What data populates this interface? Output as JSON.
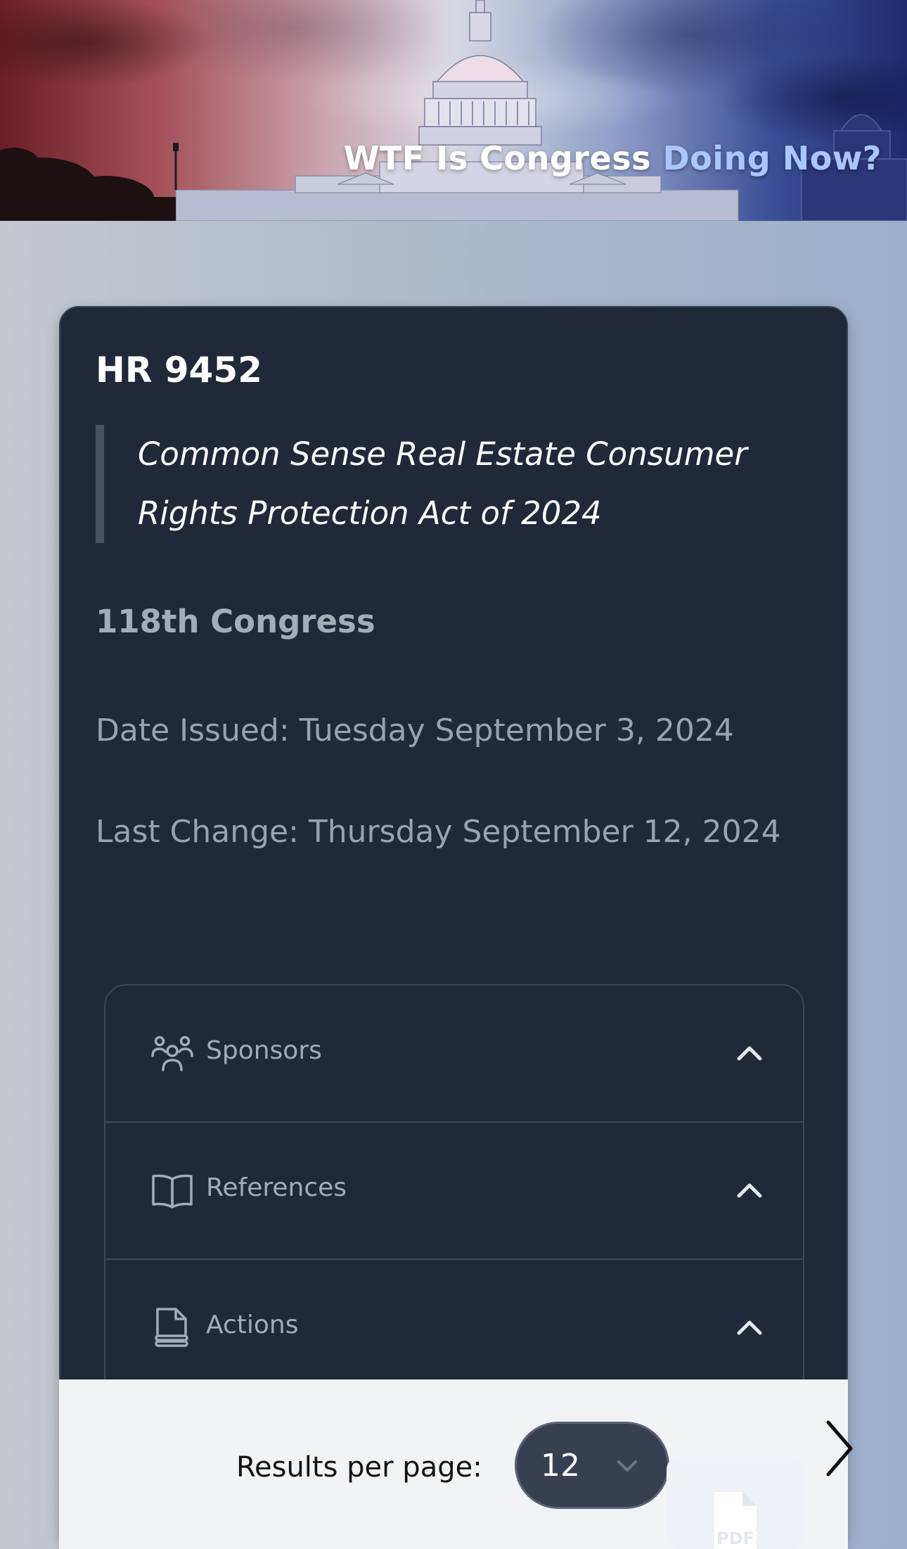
{
  "header": {
    "title_main": "WTF Is Congress",
    "title_accent": "Doing Now?"
  },
  "bill": {
    "number": "HR 9452",
    "title": "Common Sense Real Estate Consumer Rights Protection Act of 2024",
    "congress": "118th Congress",
    "date_issued": "Date Issued: Tuesday September 3, 2024",
    "last_change": "Last Change: Thursday September 12, 2024"
  },
  "accordion": {
    "items": [
      {
        "label": "Sponsors",
        "icon": "users-icon",
        "expanded": false
      },
      {
        "label": "References",
        "icon": "book-open-icon",
        "expanded": false
      },
      {
        "label": "Actions",
        "icon": "document-stack-icon",
        "expanded": false
      }
    ]
  },
  "pagination": {
    "results_label": "Results per page:",
    "per_page_value": "12",
    "next_icon": "chevron-right-icon"
  },
  "pdf": {
    "label": "PDF",
    "icon": "pdf-icon"
  },
  "colors": {
    "card_bg": "#212938",
    "page_bg_left": "#c4c8cf",
    "page_bg_right": "#9cafcd",
    "accent_text": "#a9c6ff",
    "select_bg": "#384050"
  }
}
